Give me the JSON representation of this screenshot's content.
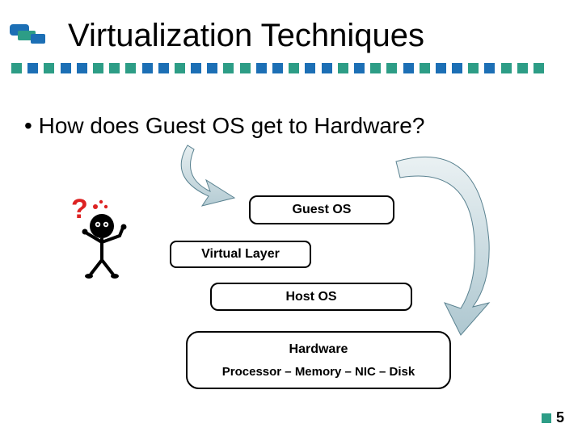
{
  "title": "Virtualization Techniques",
  "bullet": "How does Guest OS get to Hardware?",
  "boxes": {
    "guest": "Guest OS",
    "virtual": "Virtual Layer",
    "host": "Host OS",
    "hardware_title": "Hardware",
    "hardware_sub": "Processor – Memory – NIC – Disk"
  },
  "page_number": "5",
  "colors": {
    "accent_teal": "#2d9d86",
    "accent_blue": "#1c6fb5",
    "arrow_fill": "#c4d8de",
    "arrow_stroke": "#5a8290",
    "red": "#d22",
    "black": "#000"
  },
  "dot_colors": [
    "#2d9d86",
    "#1c6fb5",
    "#2d9d86",
    "#1c6fb5",
    "#1c6fb5",
    "#2d9d86",
    "#2d9d86",
    "#2d9d86",
    "#1c6fb5",
    "#1c6fb5",
    "#2d9d86",
    "#1c6fb5",
    "#1c6fb5",
    "#2d9d86",
    "#2d9d86",
    "#1c6fb5",
    "#1c6fb5",
    "#2d9d86",
    "#1c6fb5",
    "#1c6fb5",
    "#2d9d86",
    "#1c6fb5",
    "#2d9d86",
    "#2d9d86",
    "#1c6fb5",
    "#2d9d86",
    "#1c6fb5",
    "#1c6fb5",
    "#2d9d86",
    "#1c6fb5",
    "#2d9d86",
    "#2d9d86",
    "#2d9d86"
  ]
}
